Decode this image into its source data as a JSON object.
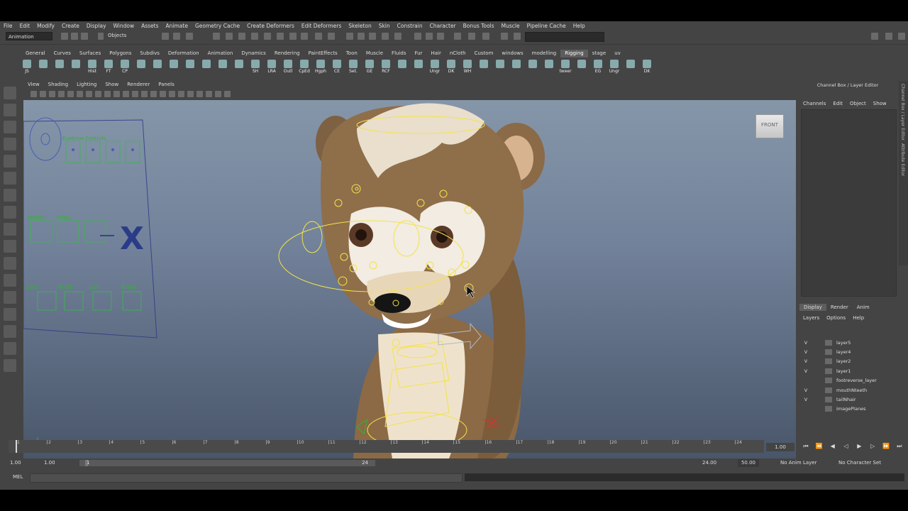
{
  "menubar": [
    "File",
    "Edit",
    "Modify",
    "Create",
    "Display",
    "Window",
    "Assets",
    "Animate",
    "Geometry Cache",
    "Create Deformers",
    "Edit Deformers",
    "Skeleton",
    "Skin",
    "Constrain",
    "Character",
    "Bonus Tools",
    "Muscle",
    "Pipeline Cache",
    "Help"
  ],
  "statusline": {
    "mode": "Animation",
    "objects_label": "Objects"
  },
  "shelf_tabs": [
    "General",
    "Curves",
    "Surfaces",
    "Polygons",
    "Subdivs",
    "Deformation",
    "Animation",
    "Dynamics",
    "Rendering",
    "PaintEffects",
    "Toon",
    "Muscle",
    "Fluids",
    "Fur",
    "Hair",
    "nCloth",
    "Custom",
    "windows",
    "modelling",
    "Rigging",
    "stage",
    "uv"
  ],
  "active_shelf_tab": "Rigging",
  "shelf_items": [
    "JS",
    "",
    "",
    "",
    "Hist",
    "FT",
    "CP",
    "",
    "",
    "",
    "",
    "",
    "",
    "",
    "SH",
    "LRA",
    "Outl",
    "CpEd",
    "Hgph",
    "CE",
    "Set.",
    "GE",
    "RCF",
    "",
    "",
    "Ungr",
    "DK",
    "WH",
    "",
    "",
    "",
    "",
    "",
    "tweer",
    "",
    "EG",
    "Ungr",
    "",
    "DK"
  ],
  "viewport_menu": [
    "View",
    "Shading",
    "Lighting",
    "Show",
    "Renderer",
    "Panels"
  ],
  "viewcube_label": "FRONT",
  "character_controls": [
    "Eyebrow Controls",
    "MOUTH",
    "CTRL",
    "X",
    "Eyes",
    "Mouth",
    "Lids",
    "Brows"
  ],
  "channel_box": {
    "title": "Channel Box / Layer Editor",
    "menu": [
      "Channels",
      "Edit",
      "Object",
      "Show"
    ]
  },
  "layer_editor": {
    "tabs": [
      "Display",
      "Render",
      "Anim"
    ],
    "active_tab": "Display",
    "menu": [
      "Layers",
      "Options",
      "Help"
    ],
    "layers": [
      {
        "visible": "V",
        "name": "layer5",
        "color": "#6a6a6a"
      },
      {
        "visible": "V",
        "name": "layer4",
        "color": "#6a6a6a"
      },
      {
        "visible": "V",
        "name": "layer2",
        "color": "#6a6a6a"
      },
      {
        "visible": "V",
        "name": "layer1",
        "color": "#6a6a6a"
      },
      {
        "visible": "",
        "name": "footreverse_layer",
        "color": "#6a6a6a"
      },
      {
        "visible": "V",
        "name": "mouthNteeth",
        "color": "#6a6a6a"
      },
      {
        "visible": "V",
        "name": "tailNhair",
        "color": "#6a6a6a"
      },
      {
        "visible": "",
        "name": "imagePlanes",
        "color": "#6a6a6a"
      }
    ]
  },
  "side_tabs": [
    "Channel Box / Layer Editor",
    "Attribute Editor"
  ],
  "timeline": {
    "labels": [
      "1",
      "2",
      "3",
      "4",
      "5",
      "6",
      "7",
      "8",
      "9",
      "10",
      "11",
      "12",
      "13",
      "14",
      "15",
      "16",
      "17",
      "18",
      "19",
      "20",
      "21",
      "22",
      "23",
      "24"
    ],
    "current_frame": "1.00"
  },
  "range": {
    "start": "1.00",
    "playback_start": "1.00",
    "slider_start": "1",
    "slider_end": "24",
    "playback_end": "24.00",
    "end": "50.00",
    "anim_layer": "No Anim Layer",
    "character_set": "No Character Set"
  },
  "command_line": {
    "label": "MEL"
  },
  "colors": {
    "ui_bg": "#444444",
    "viewport_top": "#8696a9",
    "viewport_bottom": "#49566a",
    "rig_yellow": "#f3e34a",
    "rig_green": "#2fb52f",
    "fur_brown": "#8b6a45"
  }
}
